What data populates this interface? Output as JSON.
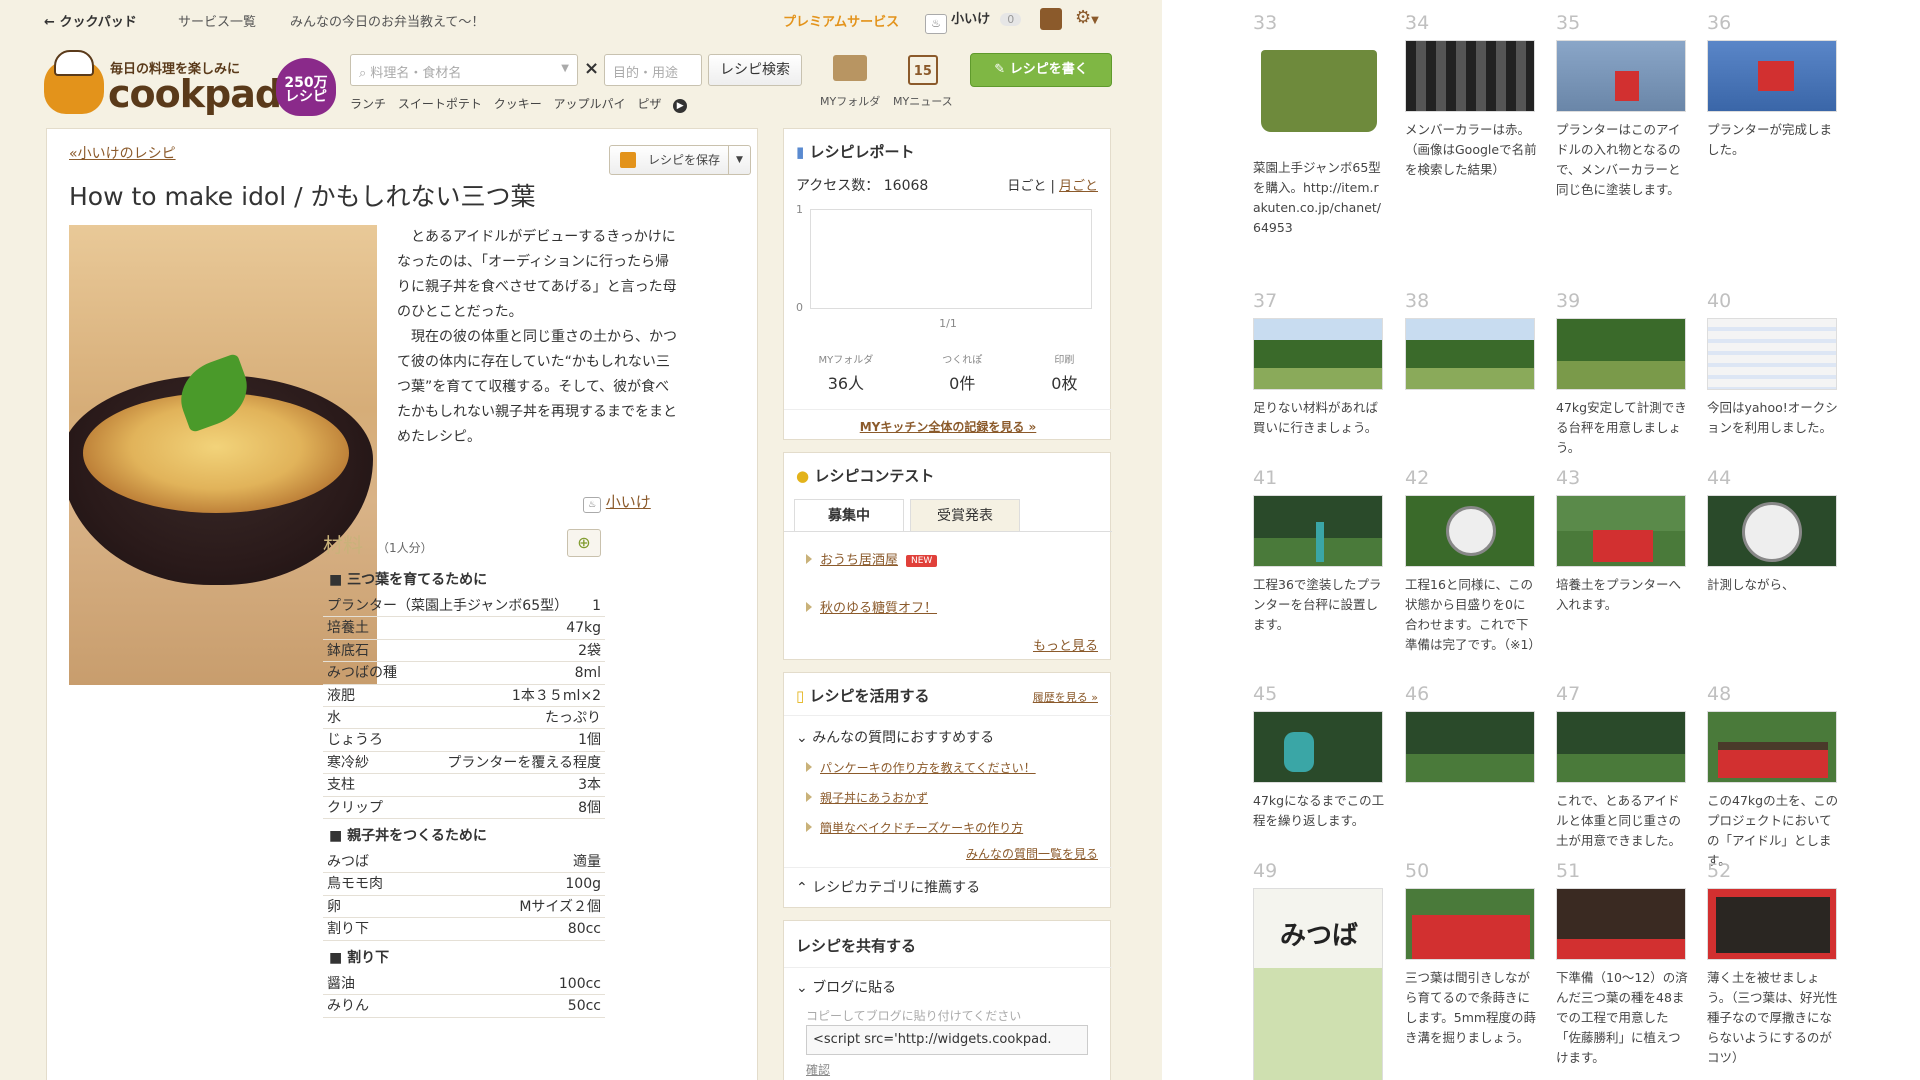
{
  "topnav": {
    "back": "クックパッド",
    "services": "サービス一覧",
    "forum": "みんなの今日のお弁当教えて〜！",
    "premium": "プレミアムサービス",
    "user": "小いけ",
    "count": "0"
  },
  "header": {
    "tagline": "毎日の料理を楽しみに",
    "logo_name": "cookpad",
    "badge": "250万 レシピ",
    "search_placeholder": "料理名・食材名",
    "purpose_placeholder": "目的・用途",
    "search_button": "レシピ検索",
    "keywords": [
      "ランチ",
      "スイートポテト",
      "クッキー",
      "アップルパイ",
      "ピザ"
    ],
    "my_folder": "MYフォルダ",
    "my_news": "MYニュース",
    "calendar_day": "15",
    "write_button": "レシピを書く"
  },
  "recipe": {
    "back_link": "«小いけのレシピ",
    "save_button": "レシピを保存",
    "title": "How to make idol / かもしれない三つ葉",
    "description": [
      "とあるアイドルがデビューするきっかけになったのは、「オーディションに行ったら帰りに親子丼を食べさせてあげる」と言った母のひとことだった。",
      "現在の彼の体重と同じ重さの土から、かつて彼の体内に存在していた“かもしれない三つ葉”を育てて収穫する。そして、彼が食べたかもしれない親子丼を再現するまでをまとめたレシピ。"
    ],
    "author": "小いけ",
    "ingredients_heading": "材料",
    "servings": "（1人分）",
    "sections": [
      {
        "title": "■ 三つ葉を育てるために",
        "items": [
          [
            "プランター（菜園上手ジャンボ65型）",
            "1"
          ],
          [
            "培養土",
            "47kg"
          ],
          [
            "鉢底石",
            "2袋"
          ],
          [
            "みつばの種",
            "8ml"
          ],
          [
            "液肥",
            "1本３５ml×2"
          ],
          [
            "水",
            "たっぷり"
          ],
          [
            "じょうろ",
            "1個"
          ],
          [
            "寒冷紗",
            "プランターを覆える程度"
          ],
          [
            "支柱",
            "3本"
          ],
          [
            "クリップ",
            "8個"
          ]
        ]
      },
      {
        "title": "■ 親子丼をつくるために",
        "items": [
          [
            "みつば",
            "適量"
          ],
          [
            "鳥モモ肉",
            "100g"
          ],
          [
            "卵",
            "Mサイズ２個"
          ],
          [
            "割り下",
            "80cc"
          ]
        ]
      },
      {
        "title": "■ 割り下",
        "items": [
          [
            "醤油",
            "100cc"
          ],
          [
            "みりん",
            "50cc"
          ]
        ]
      }
    ]
  },
  "report": {
    "title": "レシピレポート",
    "access_label": "アクセス数：",
    "access_value": "16068",
    "daily": "日ごと",
    "monthly": "月ごと",
    "y_top": "1",
    "y_bottom": "0",
    "x_label": "1/1",
    "stats": [
      {
        "label": "MYフォルダ",
        "value": "36人"
      },
      {
        "label": "つくれぽ",
        "value": "0件"
      },
      {
        "label": "印刷",
        "value": "0枚"
      }
    ],
    "kitchen_link": "MYキッチン全体の記録を見る »"
  },
  "contest": {
    "title": "レシピコンテスト",
    "tabs": [
      "募集中",
      "受賞発表"
    ],
    "items": [
      "おうち居酒屋",
      "秋のゆる糖質オフ！"
    ],
    "new_badge": "NEW",
    "more": "もっと見る"
  },
  "use": {
    "title": "レシピを活用する",
    "history": "履歴を見る »",
    "qa_heading": "みんなの質問におすすめする",
    "qa_items": [
      "パンケーキの作り方を教えてください！",
      "親子丼にあうおかず",
      "簡単なベイクドチーズケーキの作り方"
    ],
    "qa_list": "みんなの質問一覧を見る",
    "category": "レシピカテゴリに推薦する"
  },
  "share": {
    "title": "レシピを共有する",
    "blog": "ブログに貼る",
    "hint": "コピーしてブログに貼り付けてください",
    "code": "<script src='http://widgets.cookpad.",
    "confirm": "確認"
  },
  "steps": [
    {
      "n": "33",
      "cap": "菜園上手ジャンボ65型を購入。http://item.rakuten.co.jp/chanet/64953"
    },
    {
      "n": "34",
      "cap": "メンバーカラーは赤。（画像はGoogleで名前を検索した結果）"
    },
    {
      "n": "35",
      "cap": "プランターはこのアイドルの入れ物となるので、メンバーカラーと同じ色に塗装します。"
    },
    {
      "n": "36",
      "cap": "プランターが完成しました。"
    },
    {
      "n": "37",
      "cap": "足りない材料があれば買いに行きましょう。"
    },
    {
      "n": "38",
      "cap": ""
    },
    {
      "n": "39",
      "cap": "47kg安定して計測できる台秤を用意しましょう。"
    },
    {
      "n": "40",
      "cap": "今回はyahoo!オークションを利用しました。"
    },
    {
      "n": "41",
      "cap": "工程36で塗装したプランターを台秤に設置します。"
    },
    {
      "n": "42",
      "cap": "工程16と同様に、この状態から目盛りを0に合わせます。これで下準備は完了です。（※1）"
    },
    {
      "n": "43",
      "cap": "培養土をプランターへ入れます。"
    },
    {
      "n": "44",
      "cap": "計測しながら、"
    },
    {
      "n": "45",
      "cap": "47kgになるまでこの工程を繰り返します。"
    },
    {
      "n": "46",
      "cap": ""
    },
    {
      "n": "47",
      "cap": "これで、とあるアイドルと体重と同じ重さの土が用意できました。"
    },
    {
      "n": "48",
      "cap": "この47kgの土を、このプロジェクトにおいての「アイドル」とします。"
    },
    {
      "n": "49",
      "cap": ""
    },
    {
      "n": "50",
      "cap": "三つ葉は間引きしながら育てるので条蒔きにします。5mm程度の蒔き溝を掘りましょう。"
    },
    {
      "n": "51",
      "cap": "下準備（10〜12）の済んだ三つ葉の種を48までの工程で用意した「佐藤勝利」に植えつけます。"
    },
    {
      "n": "52",
      "cap": "薄く土を被せましょう。（三つ葉は、好光性種子なので厚撒きにならないようにするのがコツ）"
    }
  ],
  "packet_text": "みつば",
  "colors": {
    "accent": "#8b5a2b",
    "green": "#7fb744",
    "beige": "#f5f1e3"
  }
}
